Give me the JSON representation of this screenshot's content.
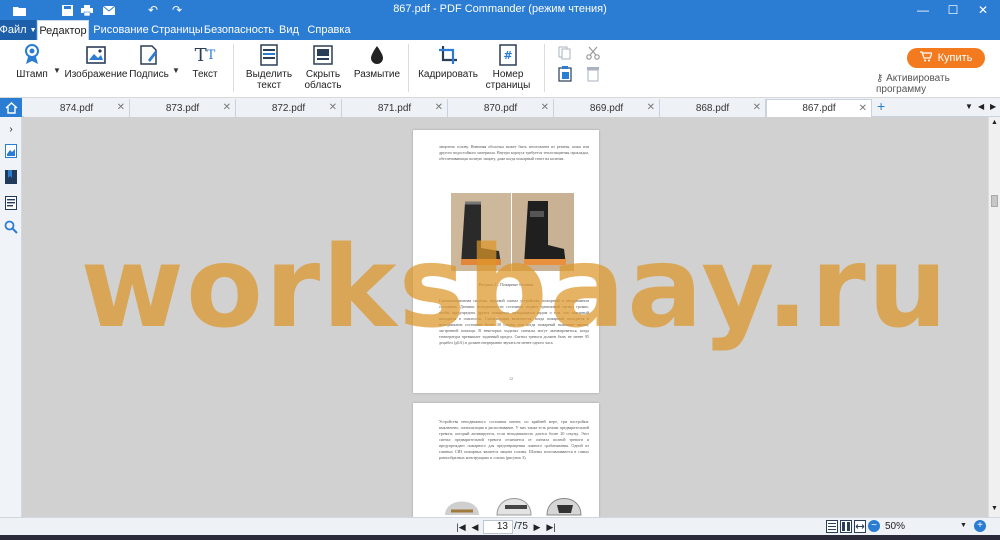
{
  "window": {
    "title": "867.pdf - PDF Commander (режим чтения)"
  },
  "menu": {
    "file": "Файл",
    "tabs": [
      "Редактор",
      "Рисование",
      "Страницы",
      "Безопасность",
      "Вид",
      "Справка"
    ]
  },
  "ribbon": {
    "stamp": "Штамп",
    "image": "Изображение",
    "signature": "Подпись",
    "text": "Текст",
    "select_text": [
      "Выделить",
      "текст"
    ],
    "hide_area": [
      "Скрыть",
      "область"
    ],
    "blur": "Размытие",
    "crop": "Кадрировать",
    "page_number": [
      "Номер",
      "страницы"
    ],
    "buy": "Купить",
    "activate": "Активировать программу"
  },
  "doc_tabs": [
    "874.pdf",
    "873.pdf",
    "872.pdf",
    "871.pdf",
    "870.pdf",
    "869.pdf",
    "868.pdf",
    "867.pdf"
  ],
  "active_tab_index": 7,
  "page1": {
    "para_top": "защитить голову. Внешняя оболочка может быть изготовлена из резины, кожи или другого водостойкого материала. Внутри корпуса требуется теплозащитная прокладка, обеспечивающая полную защиту, даже когда пожарный стоит на коленях.",
    "caption": "Рисунок 2 – Пожарные ботинки",
    "para_bottom": "Сигнализационная система, звуковой сигнал устройства, пожарный в неподвижном состоянии. Датчики неподвижности состояния подают тревожный сигнал громко, чтобы предупредить других пожарных, находящихся рядом о том, что пожарный находится в опасности. Сигнализация включается, когда пожарный находится в неподвижном состоянии более 30 секунд или когда пожарный нажимает кнопку экстренной помощи. В некоторых моделях сигналы могут активироваться, когда температура превышает заданный предел. Сигнал тревоги должен быть не менее 95 децибел (дБА) и должен непрерывно звучать не менее одного часа.",
    "number": "12"
  },
  "page2": {
    "para": "Устройства неподвижного состояния имеют, по крайней мере, три настройки: выключено, сигнализация и распознавание. У них также есть режим предварительной тревоги, который активируется, если неподвижность длится более 20 секунд. Этот сигнал предварительной тревоги отличается от сигнала полной тревоги и предупреждает пожарного для предотвращения ложного срабатывания. Одной из главных СИЗ пожарных является защита головы. Шлемы изготавливаются в самых разнообразных конструкциях и стилях (рисунок 3)."
  },
  "watermark": "worksbaay.ru",
  "status": {
    "current_page": "13",
    "total_pages": "/75",
    "zoom": "50%"
  },
  "colors": {
    "accent": "#2b7cd3",
    "buy": "#f47a1f",
    "viewer_bg": "#d1d1d1"
  }
}
